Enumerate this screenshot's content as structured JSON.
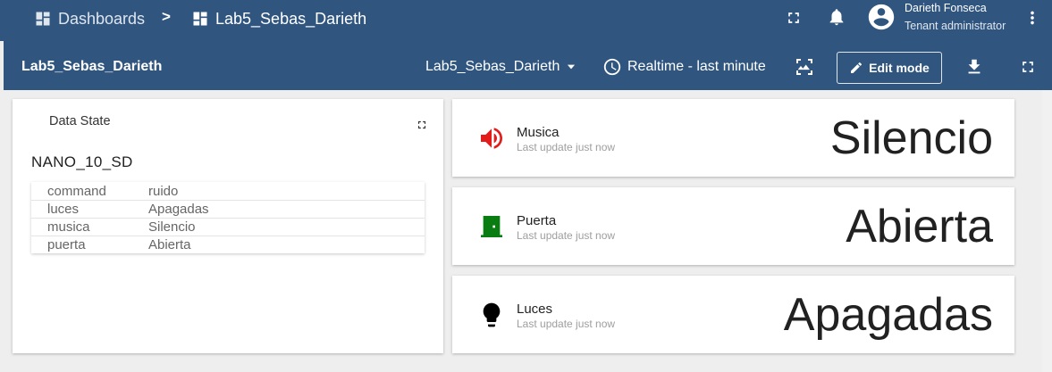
{
  "topbar": {
    "crumb_dashboards": "Dashboards",
    "separator": ">",
    "crumb_current": "Lab5_Sebas_Darieth",
    "user_name": "Darieth Fonseca",
    "user_role": "Tenant administrator",
    "icons": [
      "dashboards-icon",
      "dashboard-icon",
      "fullscreen-icon",
      "bell-icon",
      "account-icon",
      "more-vert-icon"
    ]
  },
  "dashbar": {
    "title": "Lab5_Sebas_Darieth",
    "selected_dashboard": "Lab5_Sebas_Darieth",
    "timewindow": "Realtime - last minute",
    "edit_label": "Edit mode",
    "icons": [
      "clock-icon",
      "image-icon",
      "pencil-icon",
      "download-icon",
      "fullscreen-icon"
    ]
  },
  "data_state": {
    "title": "Data State",
    "device": "NANO_10_SD",
    "rows": [
      {
        "key": "command",
        "value": "ruido"
      },
      {
        "key": "luces",
        "value": "Apagadas"
      },
      {
        "key": "musica",
        "value": "Silencio"
      },
      {
        "key": "puerta",
        "value": "Abierta"
      }
    ]
  },
  "cards": [
    {
      "label": "Musica",
      "update": "Last update just now",
      "value": "Silencio",
      "icon": "volume-up-icon",
      "icon_color": "#e31b1b"
    },
    {
      "label": "Puerta",
      "update": "Last update just now",
      "value": "Abierta",
      "icon": "door-icon",
      "icon_color": "#0a7d12"
    },
    {
      "label": "Luces",
      "update": "Last update just now",
      "value": "Apagadas",
      "icon": "lightbulb-icon",
      "icon_color": "#000000"
    }
  ],
  "colors": {
    "primary": "#305680",
    "background": "#eeeeee"
  }
}
